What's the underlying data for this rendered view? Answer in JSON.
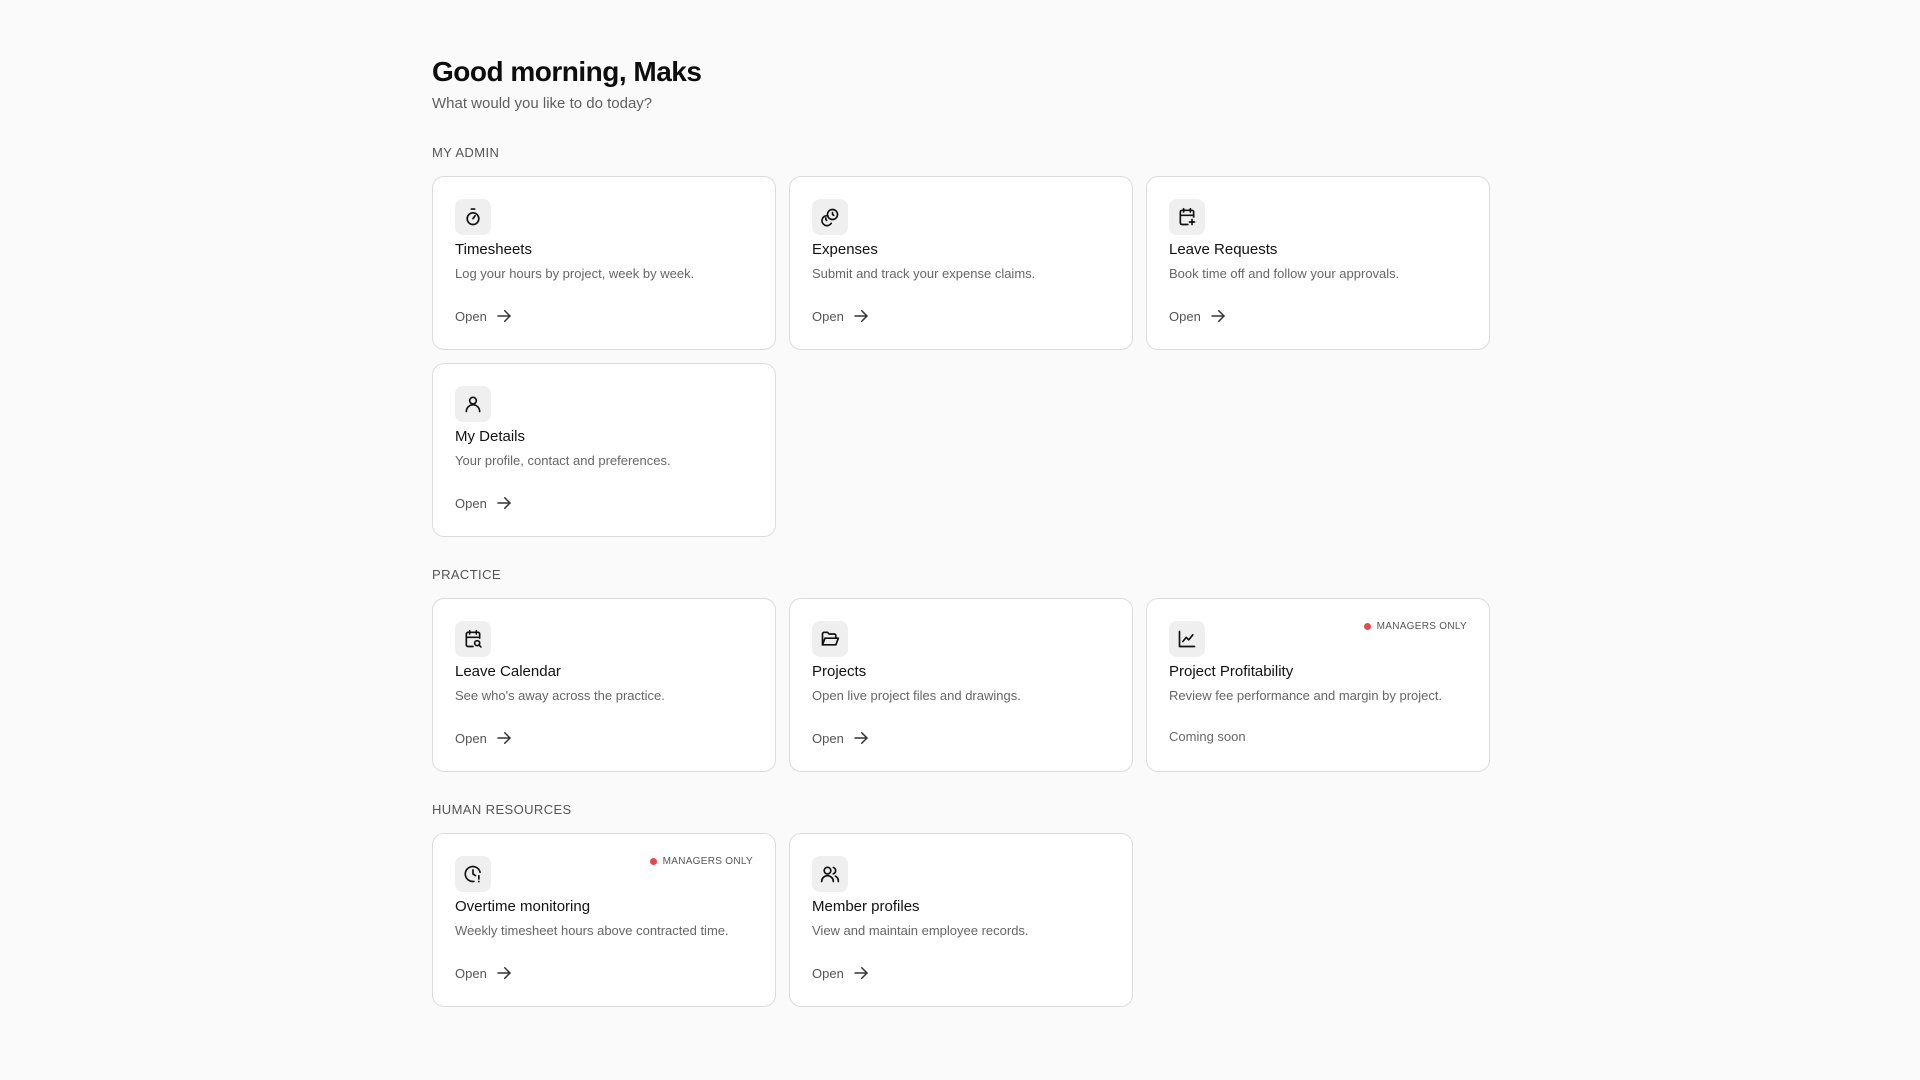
{
  "header": {
    "greeting": "Good morning, Maks",
    "subtitle": "What would you like to do today?"
  },
  "sections": {
    "my_admin": "MY ADMIN",
    "practice": "PRACTICE",
    "hr": "HUMAN RESOURCES"
  },
  "cards": {
    "timesheets": {
      "title": "Timesheets",
      "desc": "Log your hours by project, week by week.",
      "action": "Open",
      "icon": "stopwatch-icon"
    },
    "expenses": {
      "title": "Expenses",
      "desc": "Submit and track your expense claims.",
      "action": "Open",
      "icon": "coins-icon"
    },
    "leave_requests": {
      "title": "Leave Requests",
      "desc": "Book time off and follow your approvals.",
      "action": "Open",
      "icon": "calendar-plus-icon"
    },
    "my_details": {
      "title": "My Details",
      "desc": "Your profile, contact and preferences.",
      "action": "Open",
      "icon": "user-icon"
    },
    "leave_calendar": {
      "title": "Leave Calendar",
      "desc": "See who's away across the practice.",
      "action": "Open",
      "icon": "calendar-search-icon"
    },
    "projects": {
      "title": "Projects",
      "desc": "Open live project files and drawings.",
      "action": "Open",
      "icon": "folder-open-icon"
    },
    "project_profitability": {
      "title": "Project Profitability",
      "desc": "Review fee performance and margin by project.",
      "status": "Coming soon",
      "badge": "MANAGERS ONLY",
      "icon": "line-chart-icon"
    },
    "overtime": {
      "title": "Overtime monitoring",
      "desc": "Weekly timesheet hours above contracted time.",
      "action": "Open",
      "badge": "MANAGERS ONLY",
      "icon": "clock-alert-icon"
    },
    "member_profiles": {
      "title": "Member profiles",
      "desc": "View and maintain employee records.",
      "action": "Open",
      "icon": "users-icon"
    }
  },
  "colors": {
    "badge_dot": "#e5484d",
    "card_border": "#dcdcdc",
    "background": "#fafafa"
  }
}
